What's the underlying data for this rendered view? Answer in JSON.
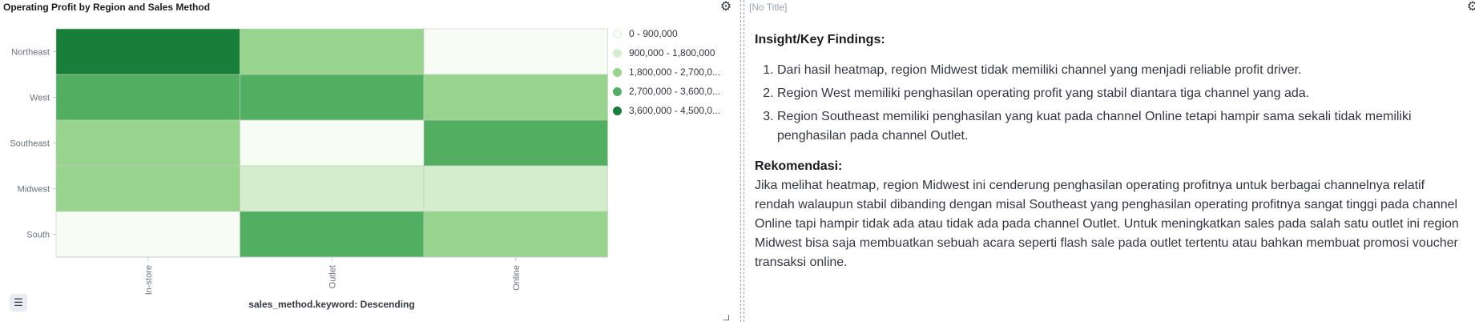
{
  "left_panel": {
    "title": "Operating Profit by Region and Sales Method",
    "gear_icon": "gear-icon",
    "list_icon": "list-icon",
    "x_axis_title": "sales_method.keyword: Descending"
  },
  "right_panel": {
    "title": "[No Title]",
    "gear_icon": "gear-icon",
    "insight_heading": "Insight/Key Findings:",
    "findings": [
      "Dari hasil heatmap, region Midwest tidak memiliki channel yang menjadi reliable profit driver.",
      "Region West memiliki penghasilan operating profit yang stabil diantara tiga channel yang ada.",
      "Region Southeast memiliki penghasilan yang kuat pada channel Online tetapi hampir sama sekali tidak memiliki penghasilan pada channel Outlet."
    ],
    "recommendation_heading": "Rekomendasi:",
    "recommendation_text": "Jika melihat heatmap, region Midwest ini cenderung penghasilan operating profitnya untuk berbagai channelnya relatif rendah walaupun stabil dibanding dengan misal Southeast yang penghasilan operating profitnya sangat tinggi pada channel Online tapi hampir tidak ada atau tidak ada pada channel Outlet. Untuk meningkatkan sales pada salah satu outlet ini region Midwest bisa saja membuatkan sebuah acara seperti flash sale pada outlet tertentu atau bahkan membuat promosi voucher transaksi online."
  },
  "chart_data": {
    "type": "heatmap",
    "title": "Operating Profit by Region and Sales Method",
    "xlabel": "sales_method.keyword: Descending",
    "ylabel": "",
    "x_categories": [
      "In-store",
      "Outlet",
      "Online"
    ],
    "y_categories": [
      "Northeast",
      "West",
      "Southeast",
      "Midwest",
      "South"
    ],
    "legend_placement": "right",
    "bins": [
      {
        "label": "0 - 900,000",
        "color": "#f7fcf5"
      },
      {
        "label": "900,000 - 1,800,000",
        "color": "#d4eecd"
      },
      {
        "label": "1,800,000 - 2,700,0...",
        "color": "#98d48d"
      },
      {
        "label": "2,700,000 - 3,600,0...",
        "color": "#52ae60"
      },
      {
        "label": "3,600,000 - 4,500,0...",
        "color": "#187f3a"
      }
    ],
    "cells_bin_index": [
      [
        4,
        2,
        0
      ],
      [
        3,
        3,
        2
      ],
      [
        2,
        0,
        3
      ],
      [
        2,
        1,
        1
      ],
      [
        0,
        3,
        2
      ]
    ]
  }
}
